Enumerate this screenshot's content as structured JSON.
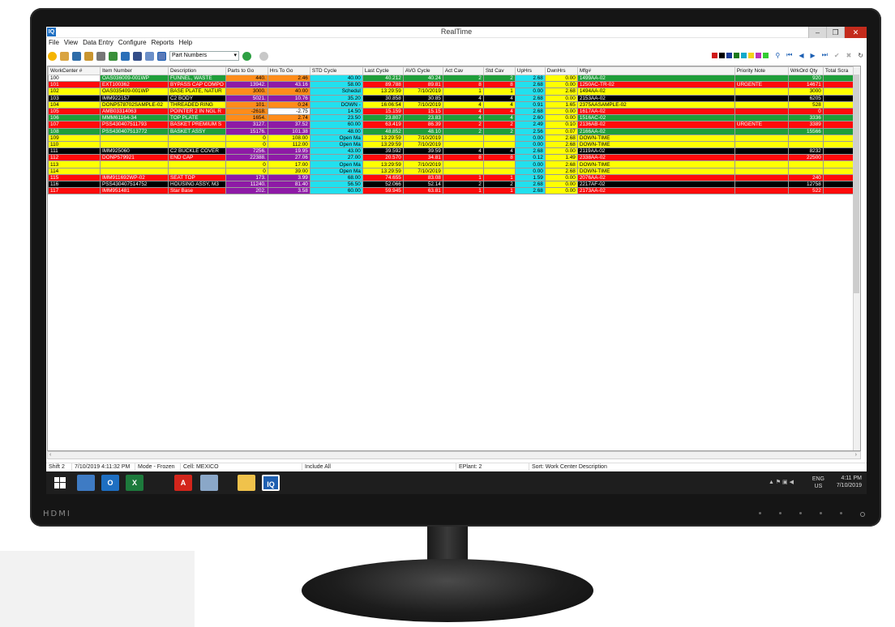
{
  "window": {
    "app_icon": "IQ",
    "title": "RealTime",
    "minimize": "‒",
    "restore": "❐",
    "close": "✕"
  },
  "menu": [
    "File",
    "View",
    "Data Entry",
    "Configure",
    "Reports",
    "Help"
  ],
  "toolbar": {
    "selector_value": "Part Numbers",
    "icons": [
      "folder-icon",
      "user-icon",
      "trash-icon",
      "users-icon",
      "print-icon",
      "report-icon",
      "chart-icon",
      "screen-icon",
      "grid-icon",
      "table-icon"
    ],
    "color_swatches": [
      "#d01818",
      "#000000",
      "#1a3c96",
      "#1c7a1c",
      "#11aacc",
      "#f2d21b",
      "#bb33bb",
      "#33cc33"
    ],
    "nav": [
      "binoculars-icon",
      "first-icon",
      "prev-icon",
      "next-icon",
      "last-icon",
      "check-icon",
      "cancel-icon",
      "refresh-icon"
    ]
  },
  "columns": [
    "WorkCenter #",
    "Item Number",
    "Description",
    "Parts to Go",
    "Hrs To Go",
    "STD Cycle",
    "Last Cycle",
    "AVG Cycle",
    "Act Cav",
    "Std Cav",
    "UpHrs",
    "DwnHrs",
    "Mfg#",
    "Priority Note",
    "WrkOrd Qty",
    "Total Scra"
  ],
  "rows": [
    {
      "wc": "100",
      "item": "OAS036009-001WP",
      "desc": "FUNNEL, WASTE",
      "parts": "440.",
      "hrs": "2.46",
      "std": "40.00",
      "last": "40.212",
      "avg": "40.24",
      "act": "2",
      "stdcav": "2",
      "up": "2.68",
      "dwn": "0.00",
      "mfg": "1499AA-02",
      "prio": "",
      "qty": "920",
      "scrap": ""
    },
    {
      "wc": "101",
      "item": "EXT100362",
      "desc": "BYPASS CAP COMPO",
      "parts": "13942.",
      "hrs": "43.16",
      "std": "58.00",
      "last": "89.788",
      "avg": "89.81",
      "act": "8",
      "stdcav": "8",
      "up": "2.68",
      "dwn": "0.00",
      "mfg": "1250AC-TR-02",
      "prio": "URGENTE",
      "qty": "14671",
      "scrap": ""
    },
    {
      "wc": "102",
      "item": "OAS035409-001WP",
      "desc": "BASE PLATE, NATUR",
      "parts": "3000.",
      "hrs": "40.00",
      "std": "Schedul",
      "last": "13:29:59",
      "avg": "7/10/2019",
      "act": "1",
      "stdcav": "1",
      "up": "0.00",
      "dwn": "2.68",
      "mfg": "1494AA-02",
      "prio": "",
      "qty": "3000",
      "scrap": ""
    },
    {
      "wc": "103",
      "item": "IMM922157",
      "desc": "C2 BODY",
      "parts": "5021.",
      "hrs": "10.76",
      "std": "35.20",
      "last": "30.858",
      "avg": "30.85",
      "act": "4",
      "stdcav": "4",
      "up": "2.68",
      "dwn": "0.00",
      "mfg": "2153AA-02",
      "prio": "",
      "qty": "6205",
      "scrap": ""
    },
    {
      "wc": "104",
      "item": "DONP578702SAMPLE-02",
      "desc": "THREADED RING",
      "parts": "101.",
      "hrs": "0.24",
      "std": "DOWN -",
      "last": "16:06:54",
      "avg": "7/10/2019",
      "act": "4",
      "stdcav": "4",
      "up": "0.91",
      "dwn": "1.65",
      "mfg": "2375AASAMPLE-02",
      "prio": "",
      "qty": "528",
      "scrap": ""
    },
    {
      "wc": "105",
      "item": "AMB03314063",
      "desc": "POINTER 2 IN NGL R",
      "parts": "-2618.",
      "hrs": "-2.75",
      "std": "14.50",
      "last": "15.159",
      "avg": "15.15",
      "act": "4",
      "stdcav": "4",
      "up": "2.68",
      "dwn": "0.00",
      "mfg": "1617AA-02",
      "prio": "",
      "qty": "0",
      "scrap": ""
    },
    {
      "wc": "106",
      "item": "MMM61164-34",
      "desc": "TOP PLATE",
      "parts": "1654.",
      "hrs": "2.74",
      "std": "23.50",
      "last": "23.807",
      "avg": "23.83",
      "act": "4",
      "stdcav": "4",
      "up": "2.60",
      "dwn": "0.00",
      "mfg": "1516AC-02",
      "prio": "",
      "qty": "3336",
      "scrap": ""
    },
    {
      "wc": "107",
      "item": "PSS430407511793",
      "desc": "BASKET PREMIUM S",
      "parts": "3127.",
      "hrs": "37.52",
      "std": "60.00",
      "last": "63.419",
      "avg": "86.39",
      "act": "2",
      "stdcav": "2",
      "up": "2.49",
      "dwn": "0.10",
      "mfg": "2136AB-02",
      "prio": "URGENTE",
      "qty": "3389",
      "scrap": ""
    },
    {
      "wc": "108",
      "item": "PSS430407513772",
      "desc": "BASKET ASSY",
      "parts": "15176.",
      "hrs": "101.38",
      "std": "48.00",
      "last": "48.852",
      "avg": "48.10",
      "act": "2",
      "stdcav": "2",
      "up": "2.56",
      "dwn": "0.07",
      "mfg": "2166AA-02",
      "prio": "",
      "qty": "15566",
      "scrap": ""
    },
    {
      "wc": "109",
      "item": "",
      "desc": "",
      "parts": "0",
      "hrs": "108.00",
      "std": "Open Ma",
      "last": "13:29:59",
      "avg": "7/10/2019",
      "act": "",
      "stdcav": "",
      "up": "0.00",
      "dwn": "2.68",
      "mfg": "DOWN-TIME",
      "prio": "",
      "qty": "",
      "scrap": ""
    },
    {
      "wc": "110",
      "item": "",
      "desc": "",
      "parts": "0",
      "hrs": "112.00",
      "std": "Open Ma",
      "last": "13:29:59",
      "avg": "7/10/2019",
      "act": "",
      "stdcav": "",
      "up": "0.00",
      "dwn": "2.68",
      "mfg": "DOWN-TIME",
      "prio": "",
      "qty": "",
      "scrap": ""
    },
    {
      "wc": "111",
      "item": "IMM925060",
      "desc": "C2 BUCKLE COVER",
      "parts": "7256.",
      "hrs": "19.95",
      "std": "43.00",
      "last": "39.592",
      "avg": "39.59",
      "act": "4",
      "stdcav": "4",
      "up": "2.68",
      "dwn": "0.00",
      "mfg": "2119AA-02",
      "prio": "",
      "qty": "8232",
      "scrap": ""
    },
    {
      "wc": "112",
      "item": "DONP579921",
      "desc": "END CAP",
      "parts": "22388.",
      "hrs": "27.06",
      "std": "27.00",
      "last": "20.570",
      "avg": "34.81",
      "act": "8",
      "stdcav": "8",
      "up": "0.12",
      "dwn": "1.49",
      "mfg": "2338AA-02",
      "prio": "",
      "qty": "22500",
      "scrap": ""
    },
    {
      "wc": "113",
      "item": "",
      "desc": "",
      "parts": "0",
      "hrs": "17.00",
      "std": "Open Ma",
      "last": "13:29:59",
      "avg": "7/10/2019",
      "act": "",
      "stdcav": "",
      "up": "0.00",
      "dwn": "2.68",
      "mfg": "DOWN-TIME",
      "prio": "",
      "qty": "",
      "scrap": ""
    },
    {
      "wc": "114",
      "item": "",
      "desc": "",
      "parts": "0",
      "hrs": "39.00",
      "std": "Open Ma",
      "last": "13:29:59",
      "avg": "7/10/2019",
      "act": "",
      "stdcav": "",
      "up": "0.00",
      "dwn": "2.68",
      "mfg": "DOWN-TIME",
      "prio": "",
      "qty": "",
      "scrap": ""
    },
    {
      "wc": "115",
      "item": "IMM911692WP-02",
      "desc": "SEAT TOP",
      "parts": "173.",
      "hrs": "3.99",
      "std": "68.00",
      "last": "74.655",
      "avg": "83.08",
      "act": "1",
      "stdcav": "1",
      "up": "1.59",
      "dwn": "0.00",
      "mfg": "2076AA-02",
      "prio": "",
      "qty": "240",
      "scrap": ""
    },
    {
      "wc": "116",
      "item": "PSS430407514752",
      "desc": "HOUSING ASSY, M3",
      "parts": "11240.",
      "hrs": "81.40",
      "std": "56.50",
      "last": "52.066",
      "avg": "52.14",
      "act": "2",
      "stdcav": "2",
      "up": "2.68",
      "dwn": "0.00",
      "mfg": "2217AF-02",
      "prio": "",
      "qty": "12758",
      "scrap": ""
    },
    {
      "wc": "117",
      "item": "IMM951481",
      "desc": "Star Base",
      "parts": "202.",
      "hrs": "3.58",
      "std": "60.00",
      "last": "59.945",
      "avg": "63.81",
      "act": "1",
      "stdcav": "1",
      "up": "2.68",
      "dwn": "0.00",
      "mfg": "2173AA-02",
      "prio": "",
      "qty": "522",
      "scrap": ""
    }
  ],
  "row_colors": {
    "green": "#1e9e3a",
    "red": "#ff0a0a",
    "yellow": "#ffff00",
    "black": "#000000",
    "orange": "#ff8c1a",
    "purple": "#8e1aa6",
    "cyan": "#22e0ee",
    "white": "#ffffff",
    "lightgreen": "#33cc33"
  },
  "status": {
    "shift": "Shift 2",
    "datetime": "7/10/2019 4:11:32 PM",
    "mode": "Mode - Frozen",
    "cell": "Cell: MEXICO",
    "include": "Include All",
    "eplant": "EPlant: 2",
    "sort": "Sort: Work Center Description"
  },
  "taskbar": {
    "apps": [
      "windows-start-icon",
      "file-server-icon",
      "outlook-icon",
      "excel-icon",
      "acrobat-icon",
      "image-viewer-icon",
      "file-explorer-icon",
      "iq-app-icon"
    ],
    "outlook_label": "O",
    "excel_label": "X",
    "acrobat_label": "A",
    "iq_label": "IQ",
    "lang": "ENG",
    "region": "US",
    "time": "4:11 PM",
    "date": "7/10/2019"
  },
  "bezel": {
    "logo": "HDMI"
  }
}
